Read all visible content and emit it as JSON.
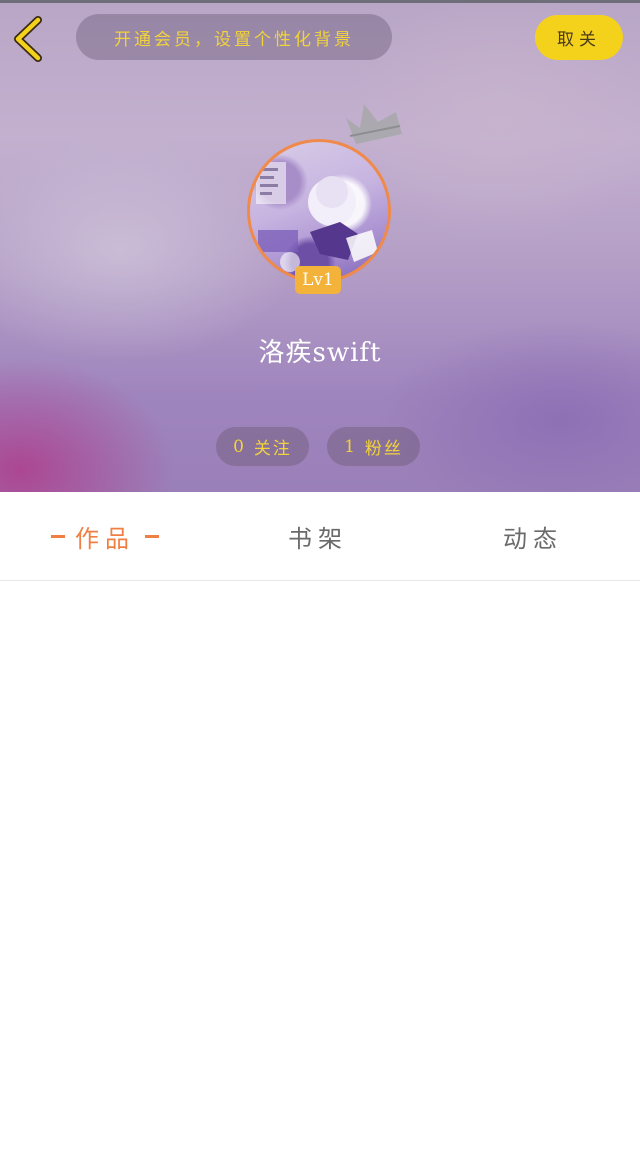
{
  "header": {
    "vip_banner": "开通会员，设置个性化背景",
    "unfollow_label": "取关",
    "username": "洛疾swift",
    "level": "Lv1",
    "following_count": "0",
    "following_label": "关注",
    "followers_count": "1",
    "followers_label": "粉丝"
  },
  "tabs": [
    {
      "label": "作品",
      "active": true
    },
    {
      "label": "书架",
      "active": false
    },
    {
      "label": "动态",
      "active": false
    }
  ],
  "icons": {
    "back": "chevron-left-icon",
    "crown": "crown-icon"
  },
  "colors": {
    "accent_yellow": "#f4d21c",
    "banner_text": "#f2d33a",
    "active_tab": "#f07f43",
    "avatar_ring": "#f08a4a",
    "level_badge": "#f3b23a"
  }
}
